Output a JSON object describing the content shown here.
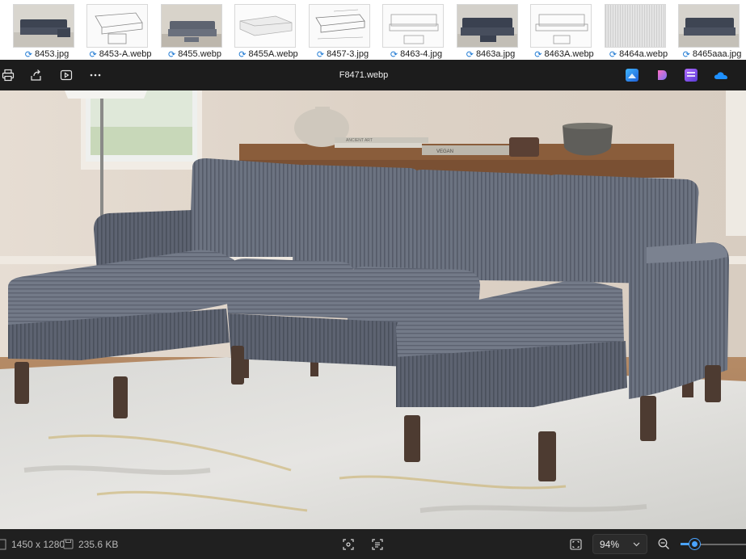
{
  "filmstrip": {
    "items": [
      {
        "name": "8453.jpg"
      },
      {
        "name": "8453-A.webp"
      },
      {
        "name": "8455.webp"
      },
      {
        "name": "8455A.webp"
      },
      {
        "name": "8457-3.jpg"
      },
      {
        "name": "8463-4.jpg"
      },
      {
        "name": "8463a.jpg"
      },
      {
        "name": "8463A.webp"
      },
      {
        "name": "8464a.webp"
      },
      {
        "name": "8465aaa.jpg"
      }
    ]
  },
  "toolbar": {
    "title": "F8471.webp"
  },
  "photo": {
    "book1_text": "ANCIENT ART",
    "book2_text": "VEGAN"
  },
  "status": {
    "dimensions": "1450 x 1280",
    "file_size": "235.6 KB",
    "zoom": "94%",
    "zoom_fraction": 0.2
  },
  "colors": {
    "toolbar_bg": "#1c1c1c",
    "accent": "#4aa3ff",
    "sync_icon": "#1976d2",
    "sofa": "#6b7180"
  }
}
